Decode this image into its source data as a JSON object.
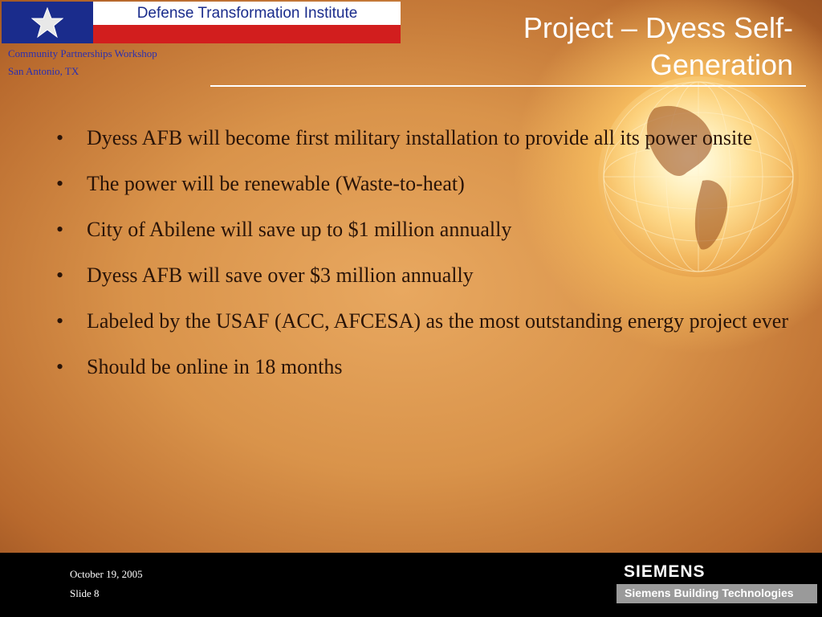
{
  "header": {
    "institute": "Defense Transformation Institute",
    "workshop_line1": "Community Partnerships Workshop",
    "workshop_line2": "San Antonio, TX"
  },
  "slide": {
    "title_line1": "Project – Dyess Self-",
    "title_line2": "Generation",
    "bullets": [
      "Dyess AFB will become first military installation to provide all its power onsite",
      "The power will be renewable (Waste-to-heat)",
      "City of Abilene will save up to $1 million annually",
      "Dyess AFB will save over $3 million annually",
      "Labeled by the USAF (ACC, AFCESA) as the most outstanding energy project ever",
      "Should be online in 18 months"
    ]
  },
  "footer": {
    "date": "October 19, 2005",
    "slide_number": "Slide 8",
    "brand": "SIEMENS",
    "brand_sub": "Siemens Building Technologies"
  },
  "colors": {
    "flag_blue": "#1a2c8c",
    "flag_red": "#d21e1e",
    "workshop_text": "#2a2fb0",
    "title_text": "#ffffff",
    "body_text": "#2a1408"
  }
}
